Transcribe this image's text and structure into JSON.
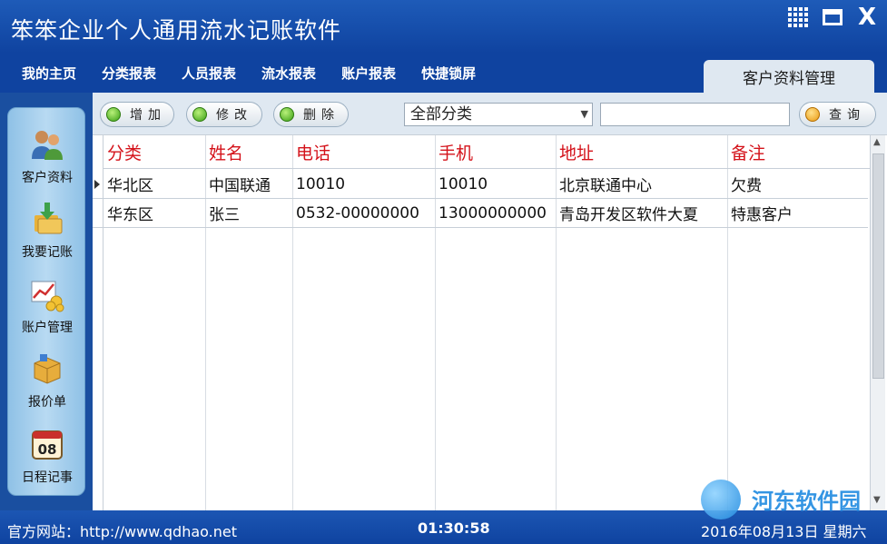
{
  "window": {
    "title": "笨笨企业个人通用流水记账软件"
  },
  "menu": [
    {
      "label": "我的主页"
    },
    {
      "label": "分类报表"
    },
    {
      "label": "人员报表"
    },
    {
      "label": "流水报表"
    },
    {
      "label": "账户报表"
    },
    {
      "label": "快捷锁屏"
    }
  ],
  "active_tab": "客户资料管理",
  "sidebar": [
    {
      "label": "客户资料",
      "icon": "customers-icon"
    },
    {
      "label": "我要记账",
      "icon": "bookkeeping-icon"
    },
    {
      "label": "账户管理",
      "icon": "account-chart-icon"
    },
    {
      "label": "报价单",
      "icon": "quote-box-icon"
    },
    {
      "label": "日程记事",
      "icon": "calendar-icon"
    }
  ],
  "calendar_day": "08",
  "toolbar": {
    "add_label": "增加",
    "edit_label": "修改",
    "delete_label": "删除",
    "category_selected": "全部分类",
    "search_value": "",
    "query_label": "查询"
  },
  "table": {
    "columns": [
      "分类",
      "姓名",
      "电话",
      "手机",
      "地址",
      "备注"
    ],
    "rows": [
      [
        "华北区",
        "中国联通",
        "10010",
        "10010",
        "北京联通中心",
        "欠费"
      ],
      [
        "华东区",
        "张三",
        "0532-00000000",
        "13000000000",
        "青岛开发区软件大夏",
        "特惠客户"
      ]
    ]
  },
  "status": {
    "website": "官方网站：http://www.qdhao.net",
    "time": "01:30:58",
    "date": "2016年08月13日 星期六"
  },
  "watermark": {
    "text": "河东软件园"
  },
  "colors": {
    "brand_blue": "#0f43a0",
    "header_red": "#d4121a",
    "panel_bg": "#dfe8f1"
  }
}
